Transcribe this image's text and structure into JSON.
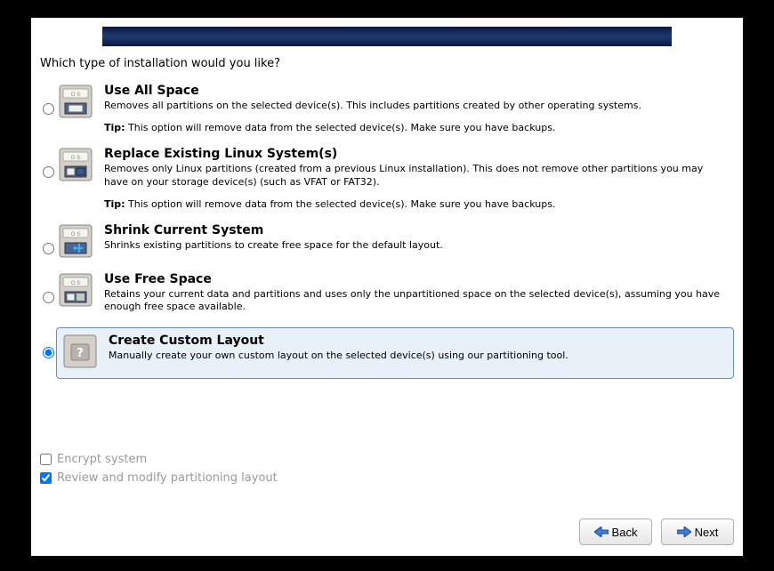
{
  "question": "Which type of installation would you like?",
  "options": [
    {
      "title": "Use All Space",
      "desc": "Removes all partitions on the selected device(s).  This includes partitions created by other operating systems.",
      "tip_label": "Tip:",
      "tip": "This option will remove data from the selected device(s).  Make sure you have backups."
    },
    {
      "title": "Replace Existing Linux System(s)",
      "desc": "Removes only Linux partitions (created from a previous Linux installation).  This does not remove other partitions you may have on your storage device(s) (such as VFAT or FAT32).",
      "tip_label": "Tip:",
      "tip": "This option will remove data from the selected device(s).  Make sure you have backups."
    },
    {
      "title": "Shrink Current System",
      "desc": "Shrinks existing partitions to create free space for the default layout."
    },
    {
      "title": "Use Free Space",
      "desc": "Retains your current data and partitions and uses only the unpartitioned space on the selected device(s), assuming you have enough free space available."
    },
    {
      "title": "Create Custom Layout",
      "desc": "Manually create your own custom layout on the selected device(s) using our partitioning tool."
    }
  ],
  "selected_index": 4,
  "checkboxes": {
    "encrypt": {
      "label": "Encrypt system",
      "checked": false
    },
    "review": {
      "label": "Review and modify partitioning layout",
      "checked": true
    }
  },
  "buttons": {
    "back": "Back",
    "next": "Next"
  }
}
